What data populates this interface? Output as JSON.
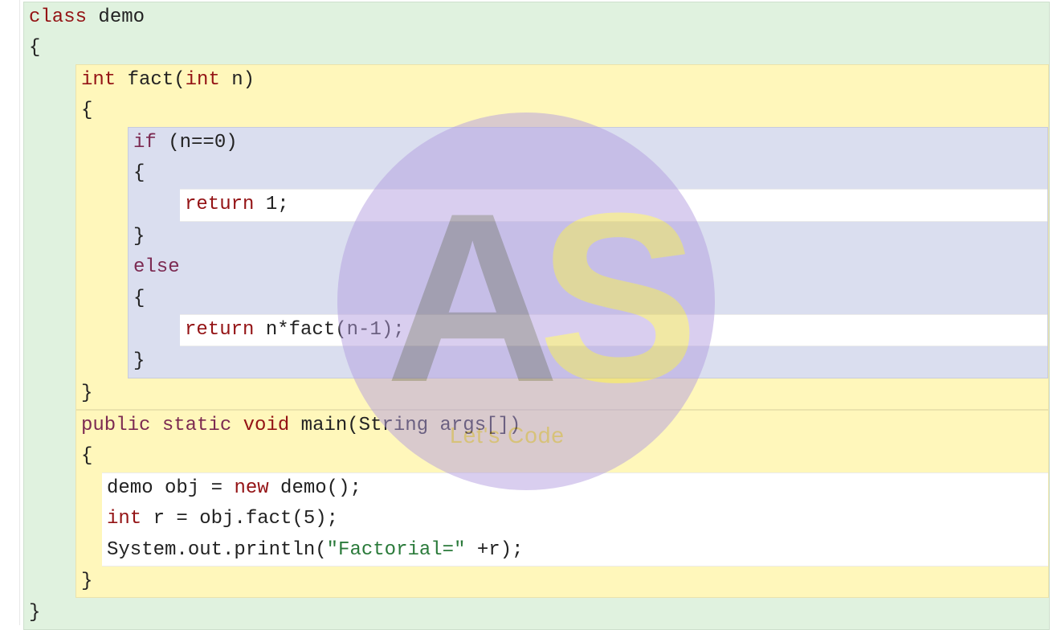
{
  "watermark": {
    "a": "A",
    "s": "S",
    "sub": "Let's Code"
  },
  "code": {
    "class_kw": "class",
    "class_name": " demo",
    "obrace": "{",
    "cbrace": "}",
    "fact_sig_int": "int",
    "fact_sig_name": " fact(",
    "fact_sig_int2": "int",
    "fact_sig_rest": " n)",
    "if_kw": "if",
    "if_cond": " (n==0)",
    "return_kw": "return",
    "return1_rest": " 1;",
    "else_kw": "else",
    "return2_rest": " n*fact(n-1);",
    "main_public": "public",
    "main_static": " static",
    "main_void": " void",
    "main_rest": " main(String args[])",
    "body1_a": "demo obj = ",
    "body1_new": "new",
    "body1_b": " demo();",
    "body2_int": "int",
    "body2_rest": " r = obj.fact(5);",
    "body3_a": "System.out.println(",
    "body3_str": "\"Factorial=\"",
    "body3_b": " +r);"
  }
}
